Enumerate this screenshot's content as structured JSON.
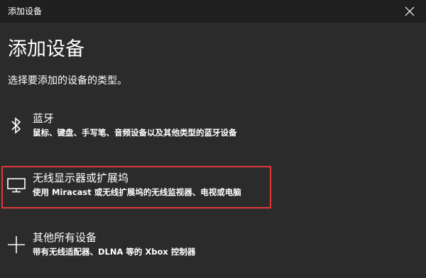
{
  "window": {
    "title": "添加设备"
  },
  "main": {
    "heading": "添加设备",
    "subtitle": "选择要添加的设备的类型。"
  },
  "options": [
    {
      "icon": "bluetooth-icon",
      "title": "蓝牙",
      "description": "鼠标、键盘、手写笔、音频设备以及其他类型的蓝牙设备"
    },
    {
      "icon": "monitor-icon",
      "title": "无线显示器或扩展坞",
      "description": "使用 Miracast 或无线扩展坞的无线监视器、电视或电脑",
      "selected": true
    },
    {
      "icon": "plus-icon",
      "title": "其他所有设备",
      "description": "带有无线适配器、DLNA 等的 Xbox 控制器"
    }
  ],
  "colors": {
    "background": "#2b2b2b",
    "titlebar": "#1f1f1f",
    "highlight_border": "#e03a3a",
    "text": "#ffffff"
  }
}
